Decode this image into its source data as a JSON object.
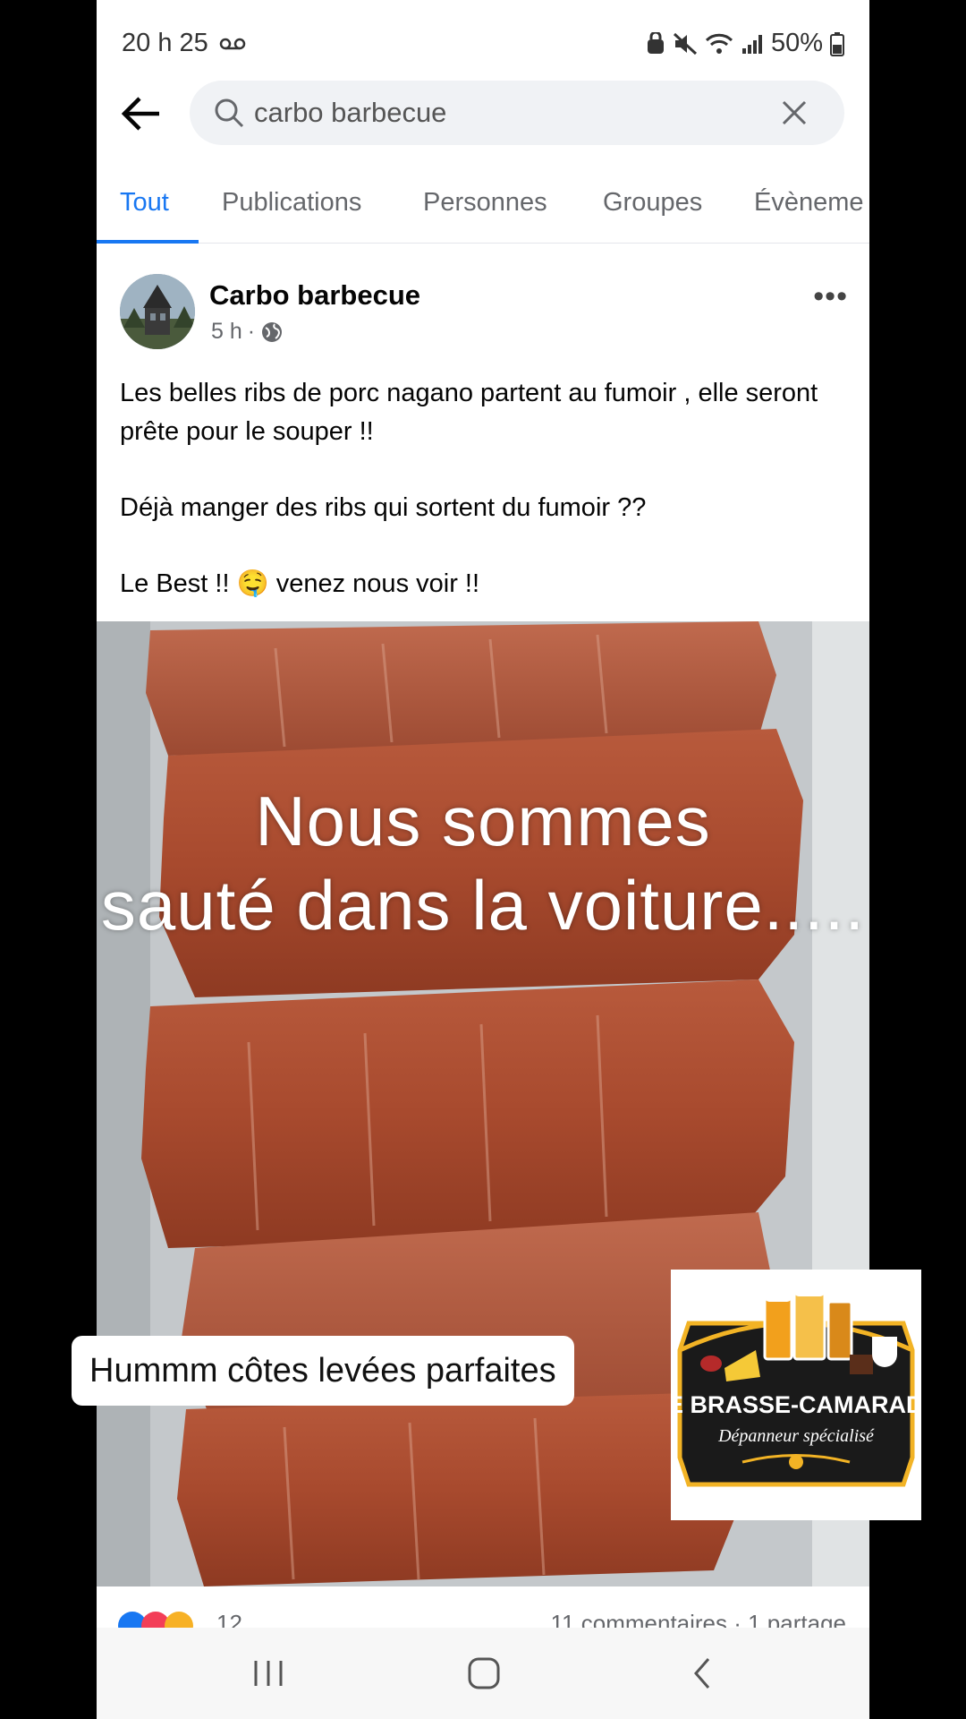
{
  "status_bar": {
    "time": "20 h 25",
    "battery": "50%"
  },
  "search": {
    "query": "carbo barbecue"
  },
  "tabs": [
    {
      "label": "Tout"
    },
    {
      "label": "Publications"
    },
    {
      "label": "Personnes"
    },
    {
      "label": "Groupes"
    },
    {
      "label": "Évèneme"
    }
  ],
  "post": {
    "author": "Carbo barbecue",
    "time": "5 h",
    "paragraphs": [
      "Les belles ribs de porc nagano partent au fumoir , elle seront prête pour le souper !!",
      "Déjà manger des ribs qui sortent du fumoir ??",
      "Le Best !! 🤤 venez nous voir !!"
    ],
    "reaction_count": "12",
    "stats": "11 commentaires · 1 partage"
  },
  "overlay": {
    "caption_line1": "Nous sommes",
    "caption_line2": "sauté dans la voiture.....",
    "sticker": "Hummm côtes levées parfaites",
    "logo_name": "LE BRASSE-CAMARADE",
    "logo_tagline": "Dépanneur spécialisé"
  },
  "colors": {
    "accent": "#1877f2",
    "logo_gold": "#f2b325"
  }
}
